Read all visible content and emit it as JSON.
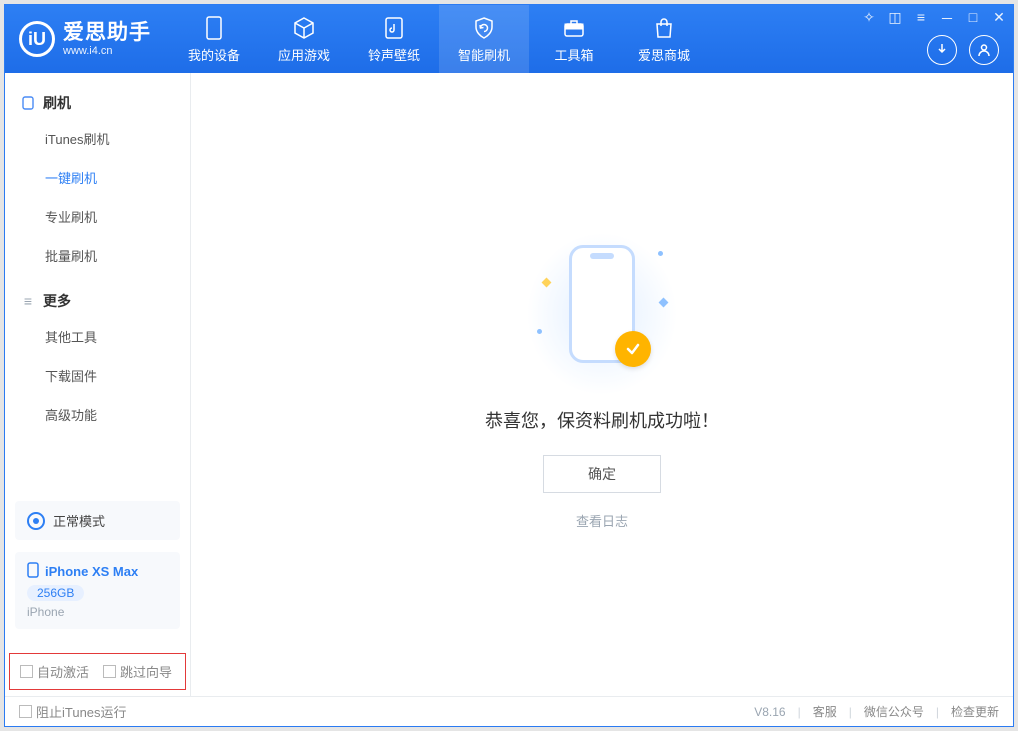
{
  "app": {
    "name_cn": "爱思助手",
    "url": "www.i4.cn"
  },
  "nav": {
    "items": [
      {
        "label": "我的设备"
      },
      {
        "label": "应用游戏"
      },
      {
        "label": "铃声壁纸"
      },
      {
        "label": "智能刷机"
      },
      {
        "label": "工具箱"
      },
      {
        "label": "爱思商城"
      }
    ],
    "active_index": 3
  },
  "sidebar": {
    "sections": [
      {
        "title": "刷机",
        "items": [
          "iTunes刷机",
          "一键刷机",
          "专业刷机",
          "批量刷机"
        ],
        "active_index": 1
      },
      {
        "title": "更多",
        "items": [
          "其他工具",
          "下载固件",
          "高级功能"
        ],
        "active_index": -1
      }
    ],
    "mode_label": "正常模式",
    "device": {
      "name": "iPhone XS Max",
      "capacity": "256GB",
      "type": "iPhone"
    },
    "highlight_opts": {
      "auto_activate": "自动激活",
      "skip_guide": "跳过向导"
    }
  },
  "main": {
    "success_msg": "恭喜您，保资料刷机成功啦！",
    "ok_label": "确定",
    "log_link": "查看日志"
  },
  "status": {
    "block_itunes": "阻止iTunes运行",
    "version": "V8.16",
    "links": [
      "客服",
      "微信公众号",
      "检查更新"
    ]
  },
  "colors": {
    "primary": "#2d7ff4",
    "accent": "#ffb400",
    "danger_border": "#e33939"
  }
}
